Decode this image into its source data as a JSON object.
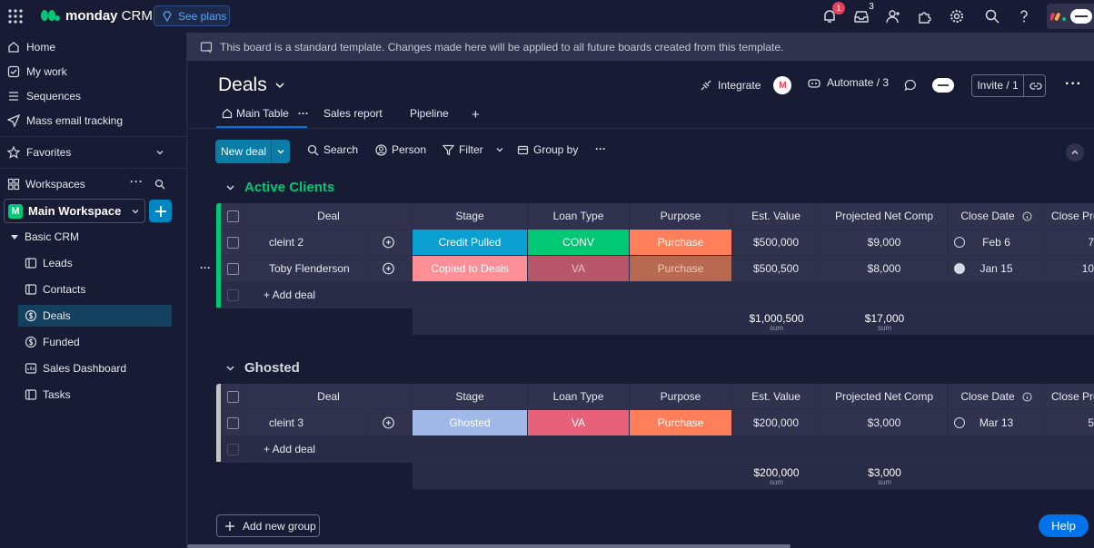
{
  "topbar": {
    "brand_bold": "monday",
    "brand_light": " CRM",
    "see_plans": "See plans",
    "notifications_count": "1",
    "inbox_count": "3"
  },
  "sidebar": {
    "nav": [
      {
        "label": "Home",
        "icon": "home-icon"
      },
      {
        "label": "My work",
        "icon": "checkbox-icon"
      },
      {
        "label": "Sequences",
        "icon": "list-icon"
      },
      {
        "label": "Mass email tracking",
        "icon": "send-icon"
      }
    ],
    "favorites": "Favorites",
    "workspaces": "Workspaces",
    "workspace_letter": "M",
    "workspace_name": "Main Workspace",
    "folder": "Basic CRM",
    "boards": [
      {
        "label": "Leads"
      },
      {
        "label": "Contacts"
      },
      {
        "label": "Deals"
      },
      {
        "label": "Funded"
      },
      {
        "label": "Sales Dashboard"
      },
      {
        "label": "Tasks"
      }
    ]
  },
  "banner": "This board is a standard template. Changes made here will be applied to all future boards created from this template.",
  "board": {
    "title": "Deals",
    "integrate": "Integrate",
    "integrate_logo": "M",
    "automate": "Automate / 3",
    "invite": "Invite / 1",
    "tabs": [
      "Main Table",
      "Sales report",
      "Pipeline"
    ]
  },
  "toolbar": {
    "new_deal": "New deal",
    "search": "Search",
    "person": "Person",
    "filter": "Filter",
    "group_by": "Group by"
  },
  "columns": [
    "Deal",
    "Stage",
    "Loan Type",
    "Purpose",
    "Est. Value",
    "Projected Net Comp",
    "Close Date",
    "Close Pro"
  ],
  "add_deal": "+ Add deal",
  "sum_label": "sum",
  "groups": [
    {
      "title": "Active Clients",
      "color": "#00c875",
      "rows": [
        {
          "deal": "cleint 2",
          "stage": "Credit Pulled",
          "stage_color": "#0a9fd1",
          "loan": "CONV",
          "loan_color": "#00c875",
          "purpose": "Purchase",
          "purpose_color": "#ff7f5a",
          "est": "$500,000",
          "net": "$9,000",
          "date": "Feb 6",
          "date_done": false,
          "prob": "7"
        },
        {
          "deal": "Toby Flenderson",
          "stage": "Copied to Deals",
          "stage_color": "#ff8f96",
          "loan": "VA",
          "loan_color": "#b7556a",
          "purpose": "Purchase",
          "purpose_color": "#b86a50",
          "est": "$500,500",
          "net": "$8,000",
          "date": "Jan 15",
          "date_done": true,
          "prob": "10"
        }
      ],
      "sum_est": "$1,000,500",
      "sum_net": "$17,000"
    },
    {
      "title": "Ghosted",
      "color": "#c4c4c4",
      "rows": [
        {
          "deal": "cleint 3",
          "stage": "Ghosted",
          "stage_color": "#a1b9e8",
          "loan": "VA",
          "loan_color": "#e8617a",
          "purpose": "Purchase",
          "purpose_color": "#ff7f5a",
          "est": "$200,000",
          "net": "$3,000",
          "date": "Mar 13",
          "date_done": false,
          "prob": "5"
        }
      ],
      "sum_est": "$200,000",
      "sum_net": "$3,000"
    }
  ],
  "add_group": "Add new group",
  "help": "Help"
}
